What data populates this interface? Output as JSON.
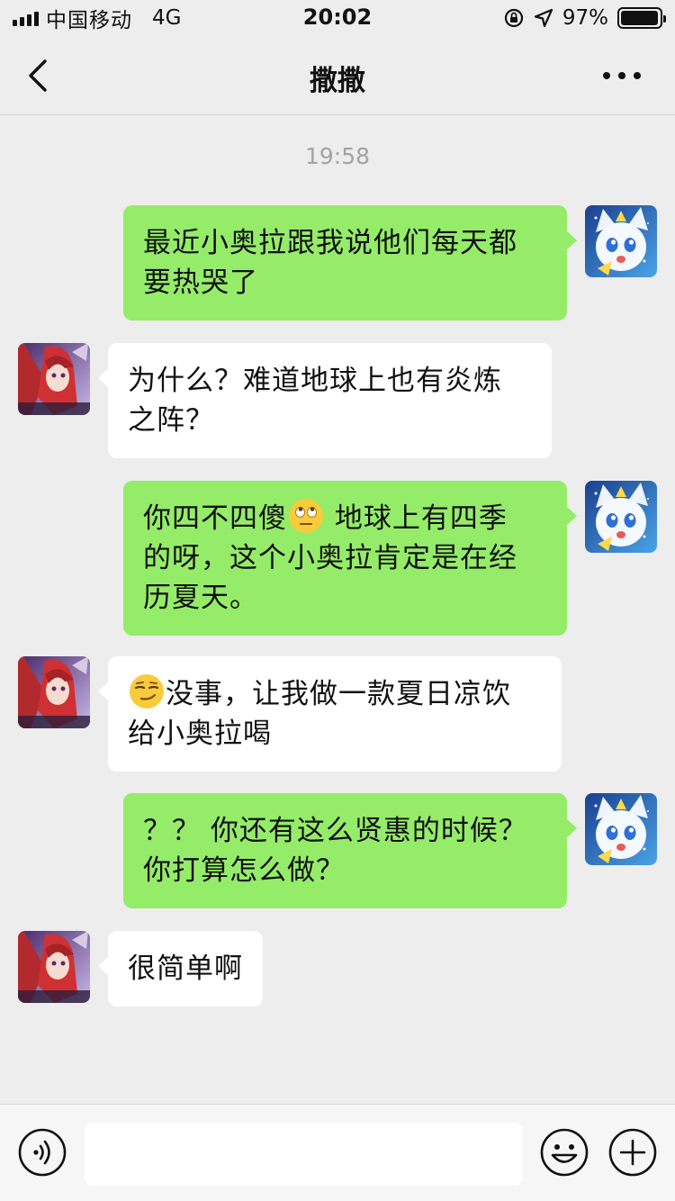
{
  "status_bar": {
    "carrier": "中国移动",
    "network": "4G",
    "time": "20:02",
    "battery_text": "97%",
    "battery_level": 0.97
  },
  "nav": {
    "back_icon": "chevron-left-icon",
    "title": "撒撒",
    "more_icon": "more-dots-icon"
  },
  "chat": {
    "timestamp": "19:58",
    "messages": [
      {
        "side": "right",
        "avatar": "blue-cat-avatar",
        "lines": [
          "最近小奥拉跟我说他们每天都",
          "要热哭了"
        ]
      },
      {
        "side": "left",
        "avatar": "red-hair-avatar",
        "lines": [
          "为什么？难道地球上也有炎炼",
          "之阵？"
        ]
      },
      {
        "side": "right",
        "avatar": "blue-cat-avatar",
        "line1_before": "你四不四傻",
        "line1_emoji": "eye-roll-emoji",
        "line1_after": " 地球上有四季",
        "lines_rest": [
          "的呀，这个小奥拉肯定是在经",
          "历夏天。"
        ]
      },
      {
        "side": "left",
        "avatar": "red-hair-avatar",
        "line1_emoji": "smirk-emoji",
        "line1_after": "没事，让我做一款夏日凉饮",
        "lines_rest": [
          "给小奥拉喝"
        ]
      },
      {
        "side": "right",
        "avatar": "blue-cat-avatar",
        "lines": [
          "？？ 你还有这么贤惠的时候？",
          "你打算怎么做？"
        ]
      },
      {
        "side": "left",
        "avatar": "red-hair-avatar",
        "lines": [
          "很简单啊"
        ]
      }
    ]
  },
  "input_bar": {
    "voice_icon": "voice-icon",
    "input_value": "",
    "emoji_icon": "emoji-icon",
    "plus_icon": "plus-icon"
  },
  "colors": {
    "background": "#ededed",
    "bubble_right": "#95ec69",
    "bubble_left": "#ffffff",
    "timestamp": "#a3a3a3"
  }
}
